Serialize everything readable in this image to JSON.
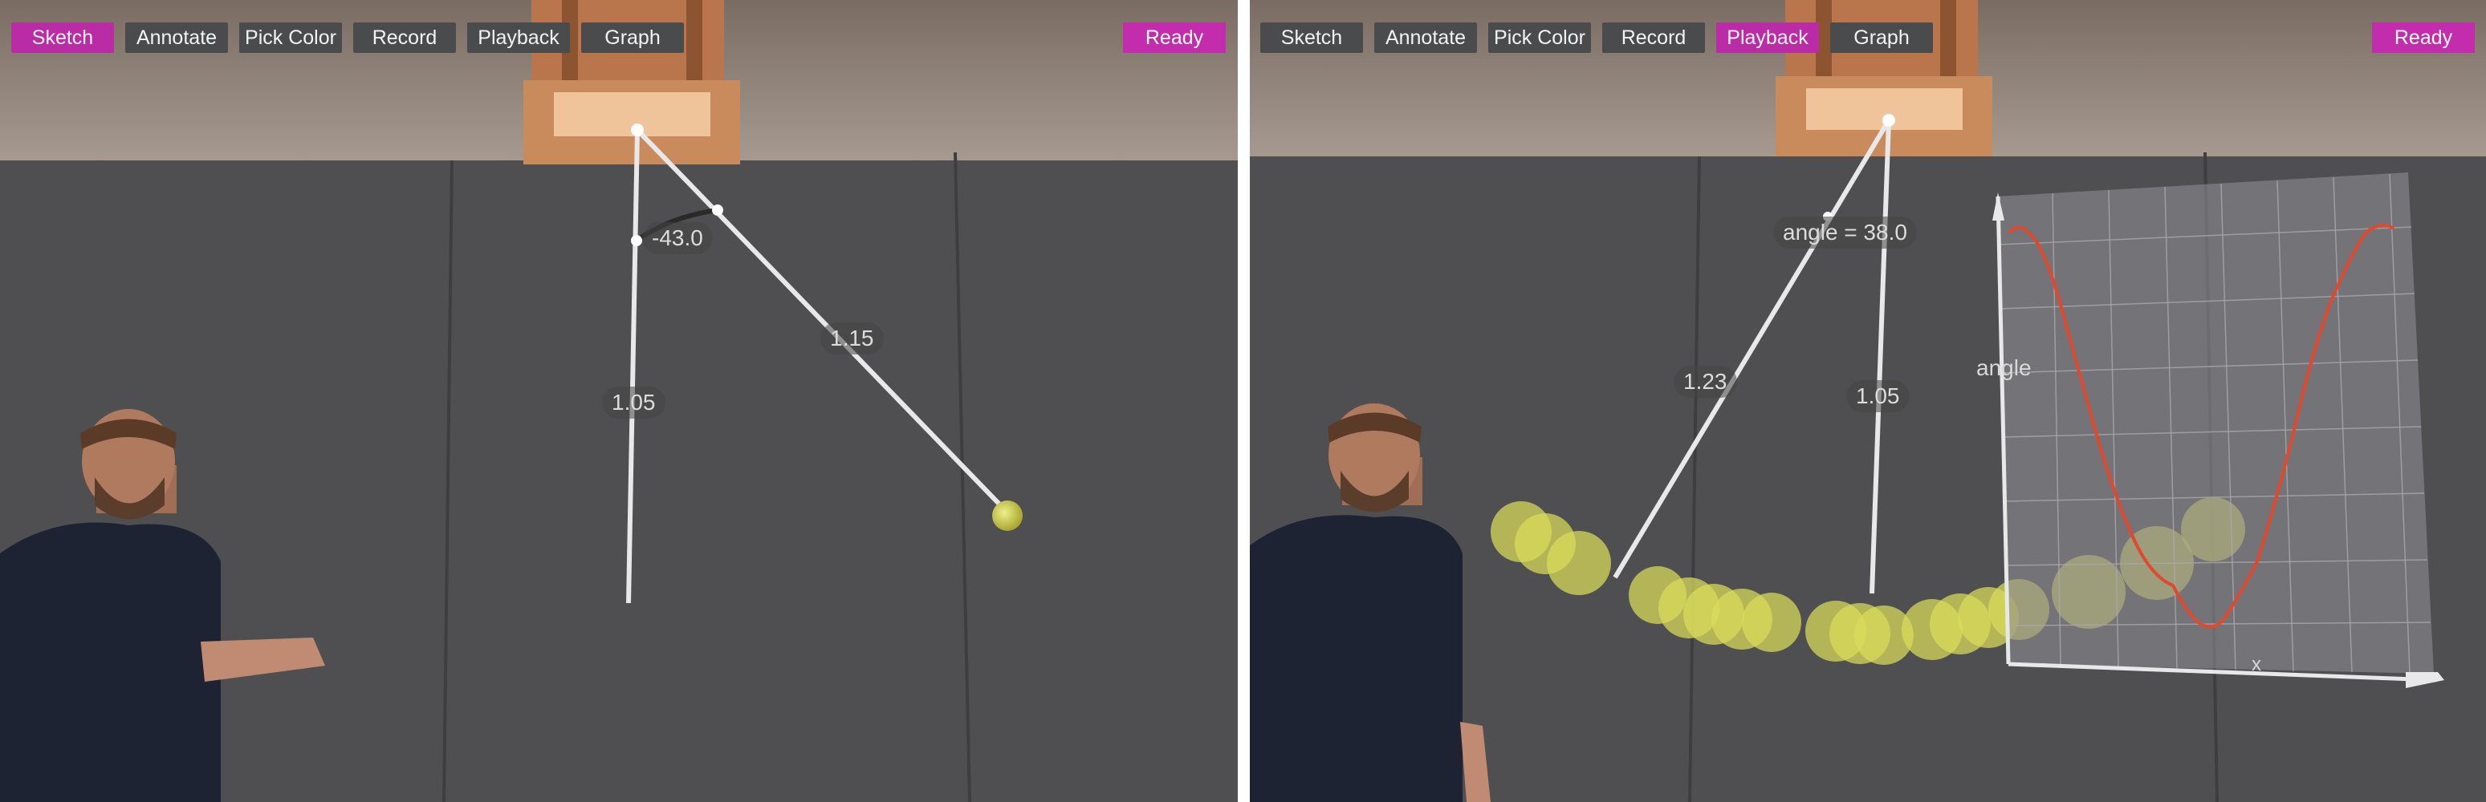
{
  "left": {
    "toolbar": [
      "Sketch",
      "Annotate",
      "Pick Color",
      "Record",
      "Playback",
      "Graph"
    ],
    "active_tool": "Sketch",
    "status": "Ready",
    "labels": {
      "angle": "-43.0",
      "rope_length": "1.15",
      "vertical_length": "1.05"
    }
  },
  "right": {
    "toolbar": [
      "Sketch",
      "Annotate",
      "Pick Color",
      "Record",
      "Playback",
      "Graph"
    ],
    "active_tool": "Playback",
    "status": "Ready",
    "labels": {
      "angle": "angle = 38.0",
      "rope_length": "1.23",
      "vertical_length": "1.05"
    },
    "graph": {
      "y_label": "angle",
      "x_label": "x"
    }
  },
  "colors": {
    "accent": "#c22cad",
    "button": "#4a4b4d",
    "trace": "#e0492e",
    "ball": "#d9dd5a"
  }
}
